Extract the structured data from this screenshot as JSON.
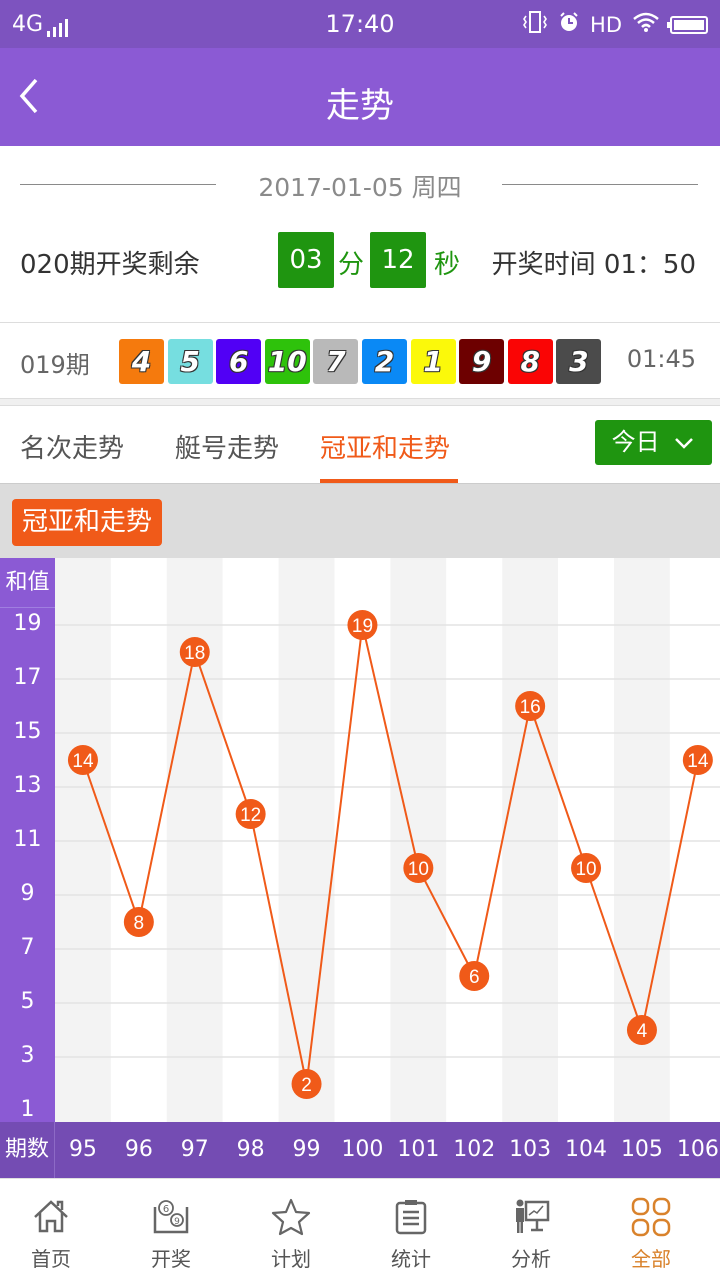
{
  "status_bar": {
    "network": "4G",
    "time": "17:40",
    "hd": "HD"
  },
  "nav": {
    "title": "走势",
    "back_icon": "chevron-left-icon"
  },
  "date_line": "2017-01-05  周四",
  "countdown": {
    "issue_text": "020期开奖剩余",
    "minutes": "03",
    "minutes_unit": "分",
    "seconds": "12",
    "seconds_unit": "秒",
    "draw_time_text": "开奖时间 01：50"
  },
  "last_draw": {
    "issue": "019期",
    "time": "01:45",
    "balls": [
      {
        "n": "4",
        "color": "#f57a0d"
      },
      {
        "n": "5",
        "color": "#76dee0"
      },
      {
        "n": "6",
        "color": "#5100f5"
      },
      {
        "n": "10",
        "color": "#2ec20b"
      },
      {
        "n": "7",
        "color": "#b9b9b9"
      },
      {
        "n": "2",
        "color": "#0a89f5"
      },
      {
        "n": "1",
        "color": "#fbf90a"
      },
      {
        "n": "9",
        "color": "#6d0000"
      },
      {
        "n": "8",
        "color": "#fa0505"
      },
      {
        "n": "3",
        "color": "#4b4b4b"
      }
    ]
  },
  "tabs": [
    {
      "label": "名次走势",
      "active": false
    },
    {
      "label": "艇号走势",
      "active": false
    },
    {
      "label": "冠亚和走势",
      "active": true
    }
  ],
  "today_button": {
    "label": "今日",
    "icon": "chevron-down-icon"
  },
  "section_badge": "冠亚和走势",
  "colors": {
    "primary_purple": "#8b5ad4",
    "accent_orange": "#f05a19",
    "green": "#1f9510"
  },
  "chart_data": {
    "type": "line",
    "title": "冠亚和走势",
    "ylabel": "和值",
    "xlabel": "期数",
    "y_ticks": [
      19,
      17,
      15,
      13,
      11,
      9,
      7,
      5,
      3,
      1
    ],
    "ylim": [
      1,
      19
    ],
    "grid": true,
    "x": [
      "95",
      "96",
      "97",
      "98",
      "99",
      "100",
      "101",
      "102",
      "103",
      "104",
      "105",
      "106"
    ],
    "series": [
      {
        "name": "冠亚和",
        "values": [
          14,
          8,
          18,
          12,
          2,
          19,
          10,
          6,
          16,
          10,
          4,
          14
        ],
        "color": "#f05a19"
      }
    ]
  },
  "bottom_nav": [
    {
      "label": "首页",
      "icon": "home-icon",
      "active": false
    },
    {
      "label": "开奖",
      "icon": "lottery-balls-icon",
      "active": false
    },
    {
      "label": "计划",
      "icon": "star-icon",
      "active": false
    },
    {
      "label": "统计",
      "icon": "clipboard-icon",
      "active": false
    },
    {
      "label": "分析",
      "icon": "presentation-chart-icon",
      "active": false
    },
    {
      "label": "全部",
      "icon": "grid-icon",
      "active": true
    }
  ]
}
